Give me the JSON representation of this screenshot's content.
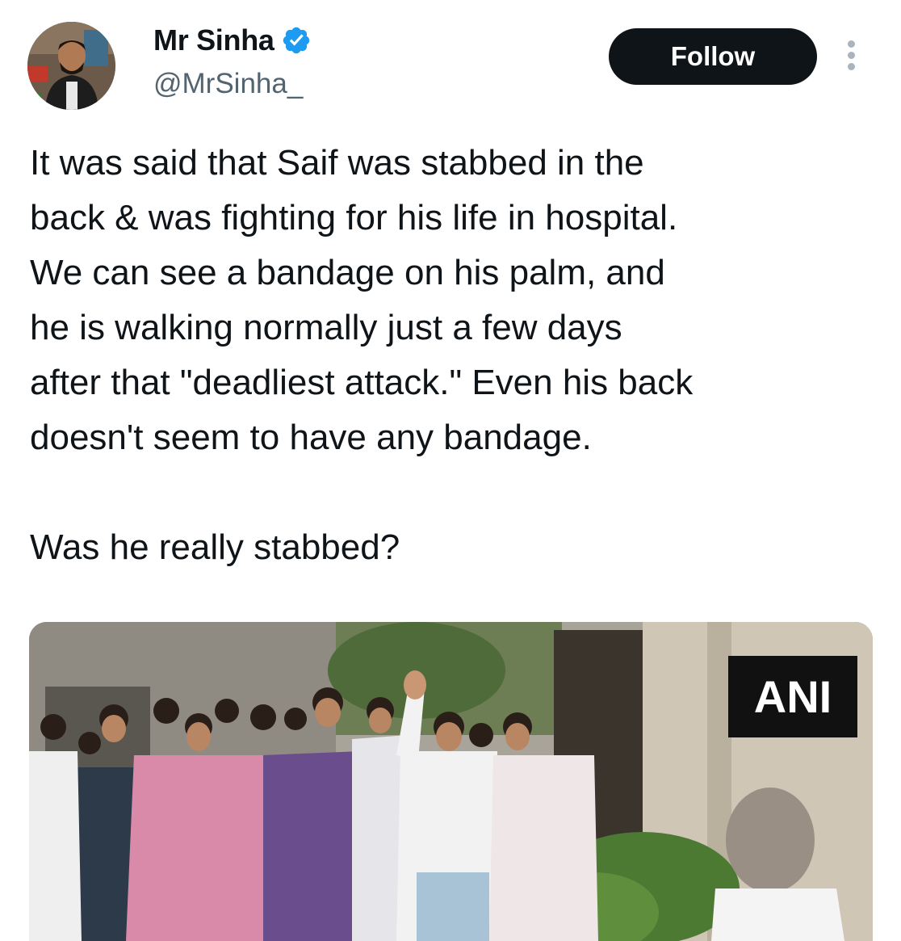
{
  "user": {
    "display_name": "Mr Sinha",
    "handle": "@MrSinha_",
    "verified": true,
    "verified_color": "#1d9bf0"
  },
  "actions": {
    "follow_label": "Follow",
    "more_icon": "more-vertical-icon"
  },
  "tweet": {
    "text": "It was said that Saif was stabbed in the\nback & was fighting for his life in hospital.\nWe can see a bandage on his palm, and\nhe is walking normally just a few days\nafter that \"deadliest attack.\" Even his back\ndoesn't seem to have any bandage.\n\nWas he really stabbed?"
  },
  "media": {
    "watermark": "ANI"
  }
}
